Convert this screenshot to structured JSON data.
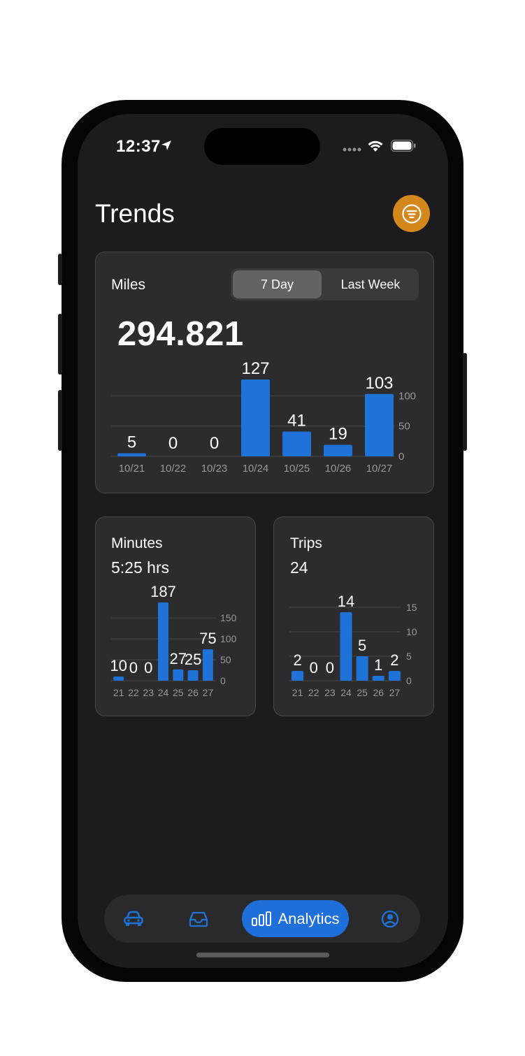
{
  "status_bar": {
    "time": "12:37"
  },
  "header": {
    "title": "Trends"
  },
  "miles_card": {
    "label": "Miles",
    "total": "294.821",
    "segments": [
      {
        "label": "7 Day",
        "selected": true
      },
      {
        "label": "Last Week",
        "selected": false
      }
    ]
  },
  "minutes_card": {
    "label": "Minutes",
    "total": "5:25 hrs"
  },
  "trips_card": {
    "label": "Trips",
    "total": "24"
  },
  "tab_bar": {
    "active_label": "Analytics"
  },
  "colors": {
    "bar": "#1f73d8",
    "accent": "#d4871a",
    "active_tab": "#1e6fd9"
  },
  "chart_data": [
    {
      "type": "bar",
      "title": "Miles",
      "categories": [
        "10/21",
        "10/22",
        "10/23",
        "10/24",
        "10/25",
        "10/26",
        "10/27"
      ],
      "values": [
        5,
        0,
        0,
        127,
        41,
        19,
        103
      ],
      "y_ticks": [
        0,
        50,
        100
      ],
      "ylim": [
        0,
        127
      ],
      "grid": true
    },
    {
      "type": "bar",
      "title": "Minutes",
      "categories": [
        "21",
        "22",
        "23",
        "24",
        "25",
        "26",
        "27"
      ],
      "values": [
        10,
        0,
        0,
        187,
        27,
        25,
        75
      ],
      "y_ticks": [
        0,
        50,
        100,
        150
      ],
      "ylim": [
        0,
        187
      ],
      "grid": true
    },
    {
      "type": "bar",
      "title": "Trips",
      "categories": [
        "21",
        "22",
        "23",
        "24",
        "25",
        "26",
        "27"
      ],
      "values": [
        2,
        0,
        0,
        14,
        5,
        1,
        2
      ],
      "y_ticks": [
        0,
        5,
        10,
        15
      ],
      "ylim": [
        0,
        15
      ],
      "grid": true
    }
  ]
}
